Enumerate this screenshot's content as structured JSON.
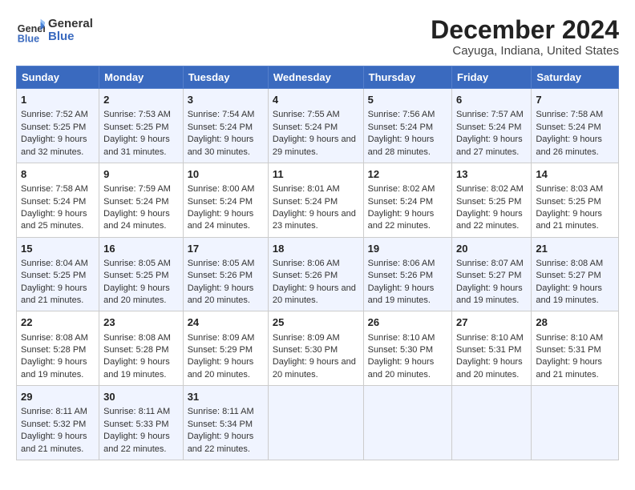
{
  "logo": {
    "line1": "General",
    "line2": "Blue"
  },
  "title": "December 2024",
  "subtitle": "Cayuga, Indiana, United States",
  "columns": [
    "Sunday",
    "Monday",
    "Tuesday",
    "Wednesday",
    "Thursday",
    "Friday",
    "Saturday"
  ],
  "weeks": [
    [
      {
        "day": "1",
        "sunrise": "7:52 AM",
        "sunset": "5:25 PM",
        "daylight": "9 hours and 32 minutes."
      },
      {
        "day": "2",
        "sunrise": "7:53 AM",
        "sunset": "5:25 PM",
        "daylight": "9 hours and 31 minutes."
      },
      {
        "day": "3",
        "sunrise": "7:54 AM",
        "sunset": "5:24 PM",
        "daylight": "9 hours and 30 minutes."
      },
      {
        "day": "4",
        "sunrise": "7:55 AM",
        "sunset": "5:24 PM",
        "daylight": "9 hours and 29 minutes."
      },
      {
        "day": "5",
        "sunrise": "7:56 AM",
        "sunset": "5:24 PM",
        "daylight": "9 hours and 28 minutes."
      },
      {
        "day": "6",
        "sunrise": "7:57 AM",
        "sunset": "5:24 PM",
        "daylight": "9 hours and 27 minutes."
      },
      {
        "day": "7",
        "sunrise": "7:58 AM",
        "sunset": "5:24 PM",
        "daylight": "9 hours and 26 minutes."
      }
    ],
    [
      {
        "day": "8",
        "sunrise": "7:58 AM",
        "sunset": "5:24 PM",
        "daylight": "9 hours and 25 minutes."
      },
      {
        "day": "9",
        "sunrise": "7:59 AM",
        "sunset": "5:24 PM",
        "daylight": "9 hours and 24 minutes."
      },
      {
        "day": "10",
        "sunrise": "8:00 AM",
        "sunset": "5:24 PM",
        "daylight": "9 hours and 24 minutes."
      },
      {
        "day": "11",
        "sunrise": "8:01 AM",
        "sunset": "5:24 PM",
        "daylight": "9 hours and 23 minutes."
      },
      {
        "day": "12",
        "sunrise": "8:02 AM",
        "sunset": "5:24 PM",
        "daylight": "9 hours and 22 minutes."
      },
      {
        "day": "13",
        "sunrise": "8:02 AM",
        "sunset": "5:25 PM",
        "daylight": "9 hours and 22 minutes."
      },
      {
        "day": "14",
        "sunrise": "8:03 AM",
        "sunset": "5:25 PM",
        "daylight": "9 hours and 21 minutes."
      }
    ],
    [
      {
        "day": "15",
        "sunrise": "8:04 AM",
        "sunset": "5:25 PM",
        "daylight": "9 hours and 21 minutes."
      },
      {
        "day": "16",
        "sunrise": "8:05 AM",
        "sunset": "5:25 PM",
        "daylight": "9 hours and 20 minutes."
      },
      {
        "day": "17",
        "sunrise": "8:05 AM",
        "sunset": "5:26 PM",
        "daylight": "9 hours and 20 minutes."
      },
      {
        "day": "18",
        "sunrise": "8:06 AM",
        "sunset": "5:26 PM",
        "daylight": "9 hours and 20 minutes."
      },
      {
        "day": "19",
        "sunrise": "8:06 AM",
        "sunset": "5:26 PM",
        "daylight": "9 hours and 19 minutes."
      },
      {
        "day": "20",
        "sunrise": "8:07 AM",
        "sunset": "5:27 PM",
        "daylight": "9 hours and 19 minutes."
      },
      {
        "day": "21",
        "sunrise": "8:08 AM",
        "sunset": "5:27 PM",
        "daylight": "9 hours and 19 minutes."
      }
    ],
    [
      {
        "day": "22",
        "sunrise": "8:08 AM",
        "sunset": "5:28 PM",
        "daylight": "9 hours and 19 minutes."
      },
      {
        "day": "23",
        "sunrise": "8:08 AM",
        "sunset": "5:28 PM",
        "daylight": "9 hours and 19 minutes."
      },
      {
        "day": "24",
        "sunrise": "8:09 AM",
        "sunset": "5:29 PM",
        "daylight": "9 hours and 20 minutes."
      },
      {
        "day": "25",
        "sunrise": "8:09 AM",
        "sunset": "5:30 PM",
        "daylight": "9 hours and 20 minutes."
      },
      {
        "day": "26",
        "sunrise": "8:10 AM",
        "sunset": "5:30 PM",
        "daylight": "9 hours and 20 minutes."
      },
      {
        "day": "27",
        "sunrise": "8:10 AM",
        "sunset": "5:31 PM",
        "daylight": "9 hours and 20 minutes."
      },
      {
        "day": "28",
        "sunrise": "8:10 AM",
        "sunset": "5:31 PM",
        "daylight": "9 hours and 21 minutes."
      }
    ],
    [
      {
        "day": "29",
        "sunrise": "8:11 AM",
        "sunset": "5:32 PM",
        "daylight": "9 hours and 21 minutes."
      },
      {
        "day": "30",
        "sunrise": "8:11 AM",
        "sunset": "5:33 PM",
        "daylight": "9 hours and 22 minutes."
      },
      {
        "day": "31",
        "sunrise": "8:11 AM",
        "sunset": "5:34 PM",
        "daylight": "9 hours and 22 minutes."
      },
      null,
      null,
      null,
      null
    ]
  ],
  "labels": {
    "sunrise": "Sunrise:",
    "sunset": "Sunset:",
    "daylight": "Daylight:"
  }
}
